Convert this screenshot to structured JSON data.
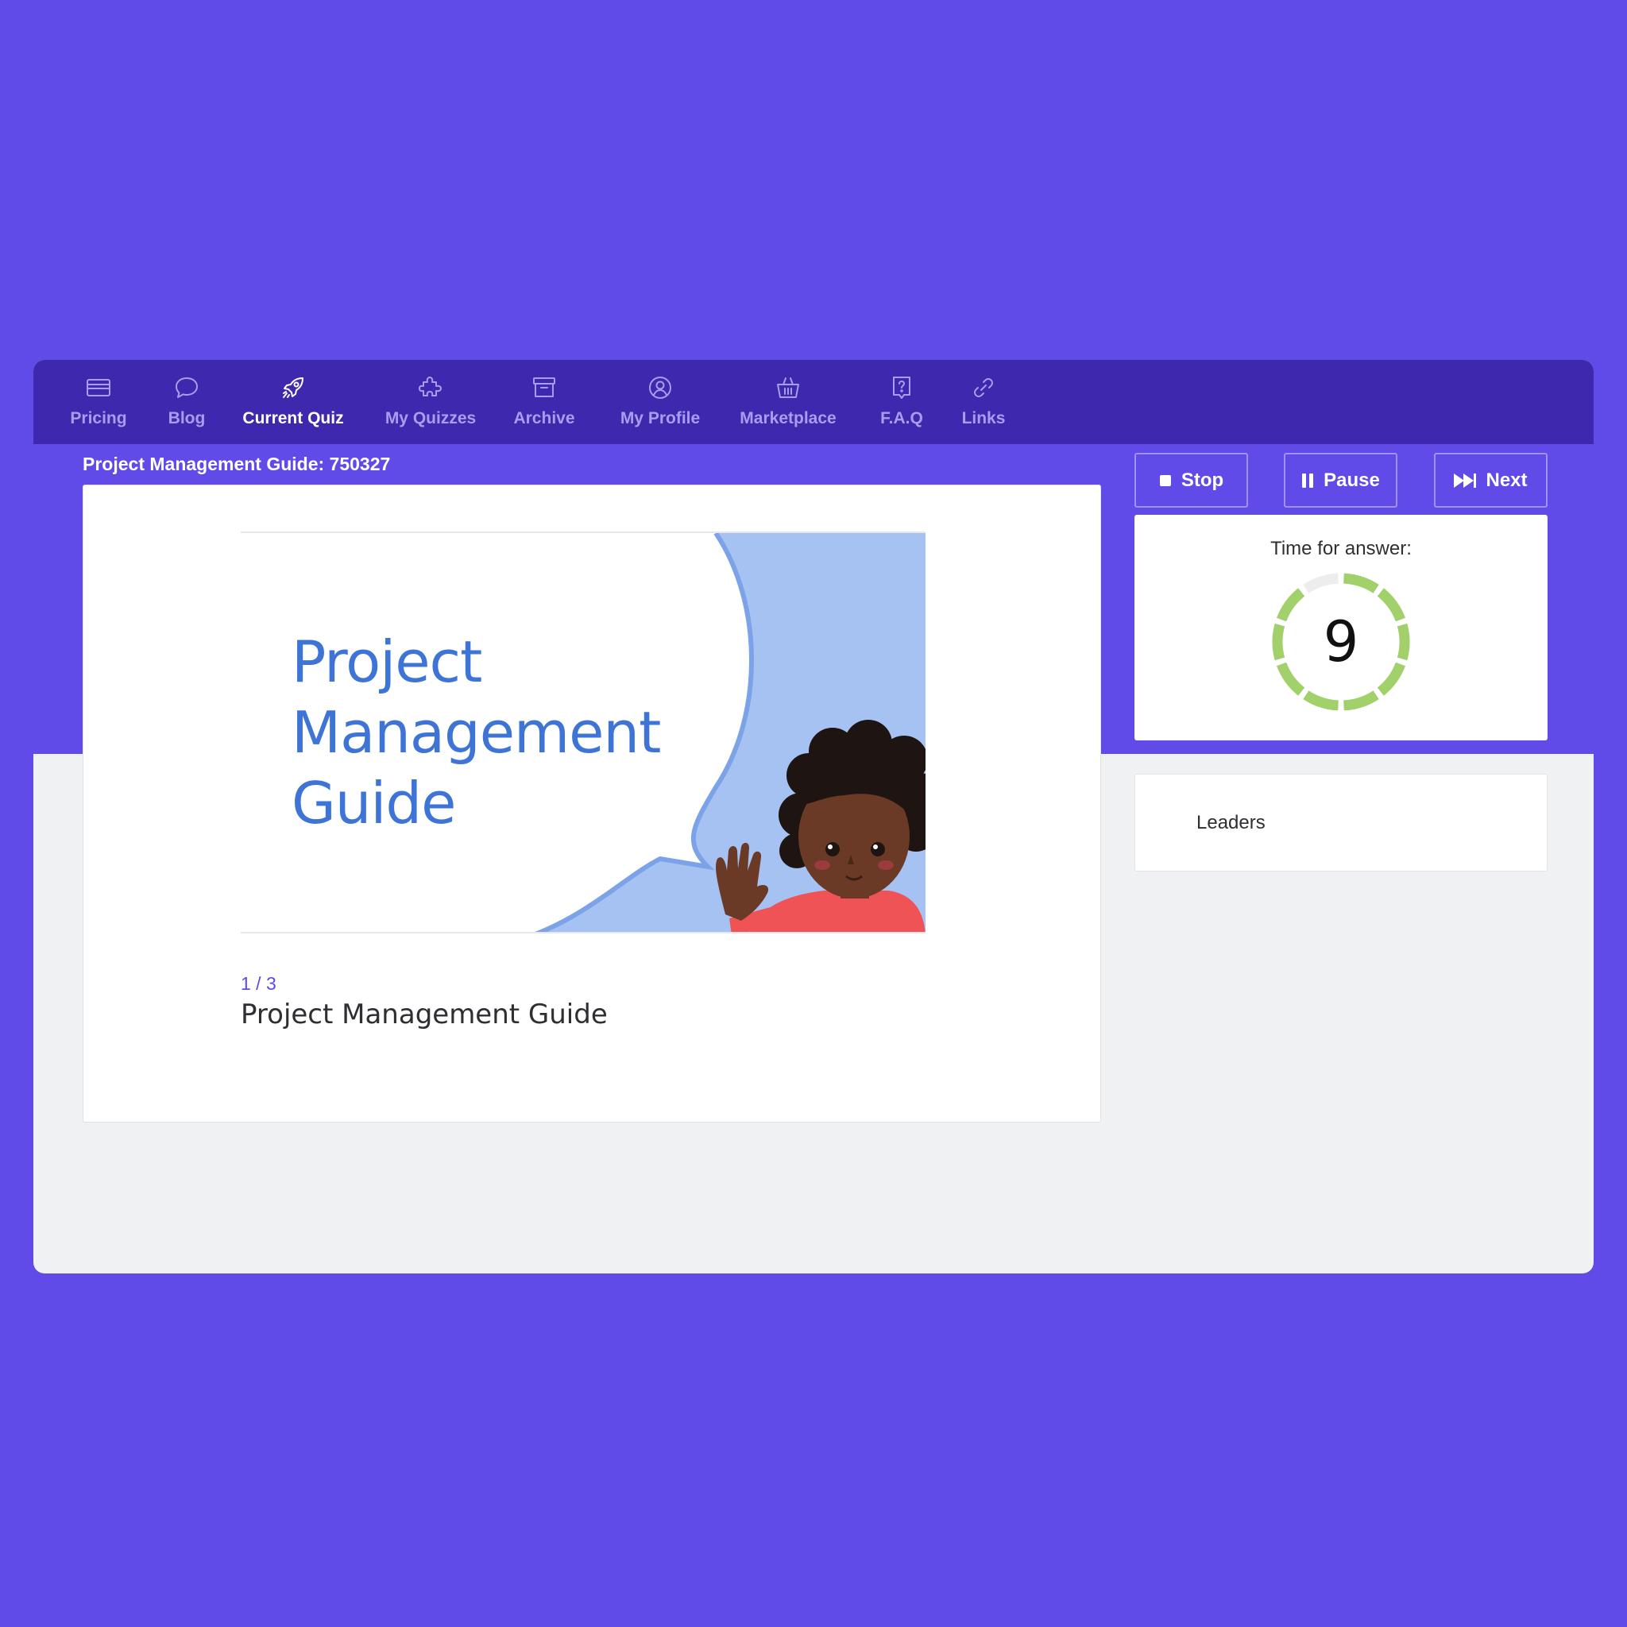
{
  "nav": {
    "items": [
      {
        "label": "Pricing",
        "icon": "pricing-icon",
        "active": false
      },
      {
        "label": "Blog",
        "icon": "chat-bubble-icon",
        "active": false
      },
      {
        "label": "Current Quiz",
        "icon": "rocket-icon",
        "active": true
      },
      {
        "label": "My Quizzes",
        "icon": "puzzle-icon",
        "active": false
      },
      {
        "label": "Archive",
        "icon": "archive-box-icon",
        "active": false
      },
      {
        "label": "My Profile",
        "icon": "user-circle-icon",
        "active": false
      },
      {
        "label": "Marketplace",
        "icon": "basket-icon",
        "active": false
      },
      {
        "label": "F.A.Q",
        "icon": "question-bubble-icon",
        "active": false
      },
      {
        "label": "Links",
        "icon": "link-icon",
        "active": false
      }
    ]
  },
  "quiz": {
    "title": "Project Management Guide: 750327",
    "slide_heading": [
      "Project",
      "Management",
      "Guide"
    ],
    "counter": "1 / 3",
    "question": "Project Management Guide"
  },
  "controls": {
    "stop_label": "Stop",
    "pause_label": "Pause",
    "next_label": "Next"
  },
  "timer": {
    "label": "Time for answer:",
    "value": "9",
    "remaining_fraction": 0.9
  },
  "leaders": {
    "title": "Leaders"
  },
  "colors": {
    "background": "#604BE8",
    "navbar": "#3E28AE",
    "nav_inactive": "#A89EF0",
    "slide_text": "#3D74D6",
    "slide_accent": "#A5C2F3",
    "timer_green": "#A2D16B",
    "timer_track": "#EDEDED"
  }
}
